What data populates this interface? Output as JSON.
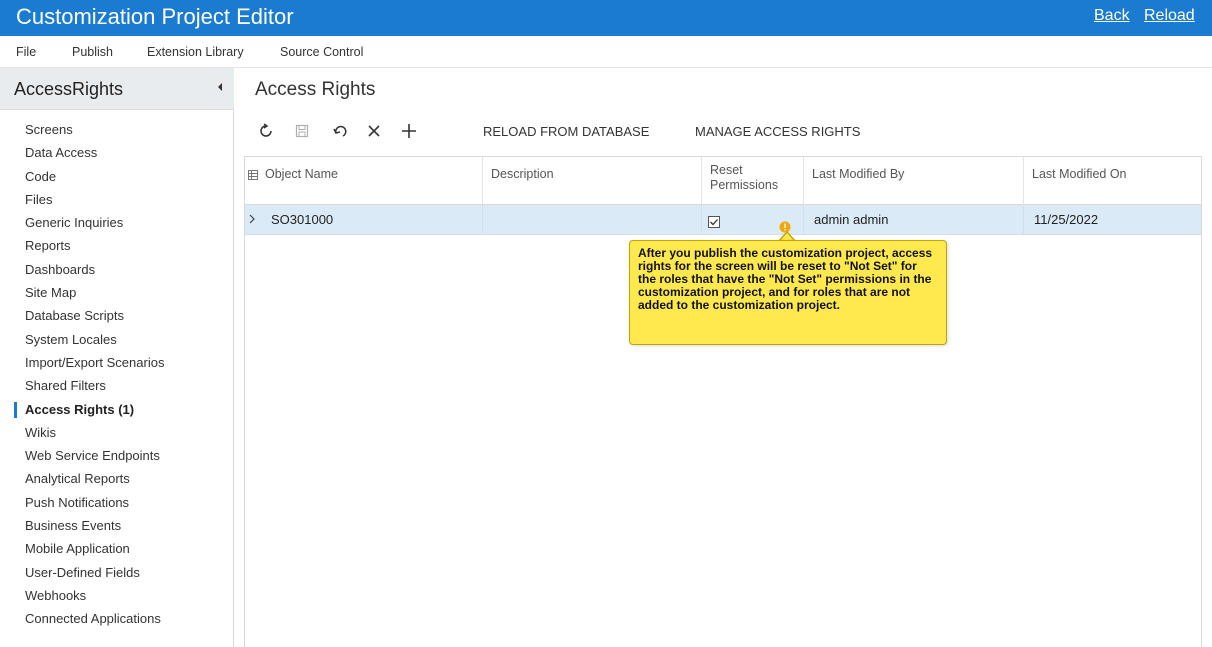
{
  "titlebar": {
    "title": "Customization Project Editor",
    "back": "Back",
    "reload": "Reload"
  },
  "menu": [
    "File",
    "Publish",
    "Extension Library",
    "Source Control"
  ],
  "sidebar": {
    "title": "AccessRights",
    "items": [
      {
        "label": "Screens",
        "active": false
      },
      {
        "label": "Data Access",
        "active": false
      },
      {
        "label": "Code",
        "active": false
      },
      {
        "label": "Files",
        "active": false
      },
      {
        "label": "Generic Inquiries",
        "active": false
      },
      {
        "label": "Reports",
        "active": false
      },
      {
        "label": "Dashboards",
        "active": false
      },
      {
        "label": "Site Map",
        "active": false
      },
      {
        "label": "Database Scripts",
        "active": false
      },
      {
        "label": "System Locales",
        "active": false
      },
      {
        "label": "Import/Export Scenarios",
        "active": false
      },
      {
        "label": "Shared Filters",
        "active": false
      },
      {
        "label": "Access Rights (1)",
        "active": true
      },
      {
        "label": "Wikis",
        "active": false
      },
      {
        "label": "Web Service Endpoints",
        "active": false
      },
      {
        "label": "Analytical Reports",
        "active": false
      },
      {
        "label": "Push Notifications",
        "active": false
      },
      {
        "label": "Business Events",
        "active": false
      },
      {
        "label": "Mobile Application",
        "active": false
      },
      {
        "label": "User-Defined Fields",
        "active": false
      },
      {
        "label": "Webhooks",
        "active": false
      },
      {
        "label": "Connected Applications",
        "active": false
      }
    ]
  },
  "main": {
    "title": "Access Rights",
    "toolbar": {
      "icons": [
        "refresh-icon",
        "save-icon",
        "undo-icon",
        "delete-icon",
        "add-icon"
      ],
      "reload_from_db": "RELOAD FROM DATABASE",
      "manage_access": "MANAGE ACCESS RIGHTS"
    },
    "grid": {
      "columns": [
        "Object Name",
        "Description",
        "Reset Permissions",
        "Last Modified By",
        "Last Modified On"
      ],
      "rows": [
        {
          "object_name": "SO301000",
          "description": "",
          "reset_permissions": true,
          "last_modified_by": "admin admin",
          "last_modified_on": "11/25/2022"
        }
      ]
    },
    "tooltip": "After you publish the customization project, access rights for the screen will be reset to \"Not Set\" for the roles that have the \"Not Set\" permissions in the customization project, and for roles that are not added to the customization project."
  },
  "colors": {
    "titlebar": "#1a7bd0",
    "selected_row": "#dbeaf7",
    "tooltip": "#ffe94f",
    "warning_icon": "#f0a800"
  }
}
